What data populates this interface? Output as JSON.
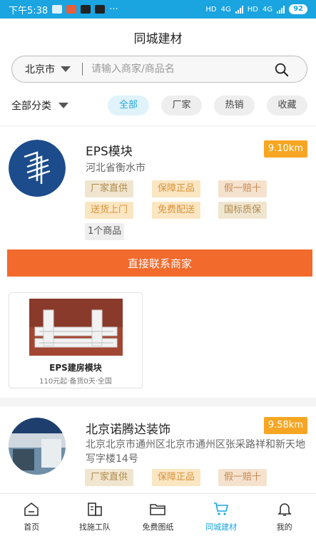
{
  "status_bar": {
    "time": "下午5:38",
    "network_left": "HD",
    "signal_left": "4G",
    "network_right": "HD",
    "signal_right": "4G",
    "battery": "92"
  },
  "header": {
    "title": "同城建材"
  },
  "search": {
    "city": "北京市",
    "placeholder": "请输入商家/商品名"
  },
  "filter": {
    "category": "全部分类",
    "chips": [
      "全部",
      "厂家",
      "热销",
      "收藏"
    ],
    "active_chip": "全部"
  },
  "merchants": [
    {
      "name": "EPS模块",
      "distance": "9.10km",
      "address": "河北省衡水市",
      "tags": [
        "厂家直供",
        "保障正品",
        "假一赔十",
        "送货上门",
        "免费配送",
        "国标质保"
      ],
      "product_count": "1个商品",
      "contact_label": "直接联系商家",
      "products": [
        {
          "name": "EPS建房模块",
          "meta": "110元起·备货0天·全国"
        }
      ]
    },
    {
      "name": "北京诺腾达装饰",
      "distance": "9.58km",
      "address": "北京北京市通州区北京市通州区张采路祥和新天地写字楼14号",
      "tags": [
        "厂家直供",
        "保障正品",
        "假一赔十"
      ]
    }
  ],
  "bottom_nav": [
    {
      "label": "首页",
      "icon": "home-icon"
    },
    {
      "label": "找施工队",
      "icon": "building-icon"
    },
    {
      "label": "免费图纸",
      "icon": "folder-icon"
    },
    {
      "label": "同城建材",
      "icon": "cart-icon",
      "active": true
    },
    {
      "label": "我的",
      "icon": "bell-icon"
    }
  ],
  "colors": {
    "accent": "#1aa4e0",
    "contact_button": "#f26a2c",
    "distance_badge": "#f6a623"
  }
}
